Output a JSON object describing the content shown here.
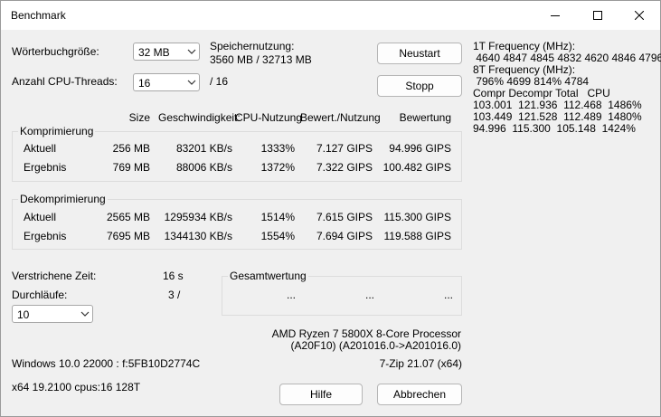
{
  "window": {
    "title": "Benchmark"
  },
  "settings": {
    "dict_label": "Wörterbuchgröße:",
    "dict_value": "32 MB",
    "threads_label": "Anzahl CPU-Threads:",
    "threads_value": "16",
    "threads_total": "/ 16",
    "memory_label": "Speichernutzung:",
    "memory_value": "3560 MB / 32713 MB"
  },
  "buttons": {
    "restart": "Neustart",
    "stop": "Stopp",
    "help": "Hilfe",
    "cancel": "Abbrechen"
  },
  "headers": {
    "size": "Size",
    "speed": "Geschwindigkeit:",
    "cpu": "CPU-Nutzung",
    "rating_usage": "Bewert./Nutzung",
    "rating": "Bewertung"
  },
  "compression": {
    "title": "Komprimierung",
    "rows": [
      {
        "label": "Aktuell",
        "size": "256 MB",
        "speed": "83201 KB/s",
        "cpu": "1333%",
        "rpu": "7.127 GIPS",
        "rating": "94.996 GIPS"
      },
      {
        "label": "Ergebnis",
        "size": "769 MB",
        "speed": "88006 KB/s",
        "cpu": "1372%",
        "rpu": "7.322 GIPS",
        "rating": "100.482 GIPS"
      }
    ]
  },
  "decompression": {
    "title": "Dekomprimierung",
    "rows": [
      {
        "label": "Aktuell",
        "size": "2565 MB",
        "speed": "1295934 KB/s",
        "cpu": "1514%",
        "rpu": "7.615 GIPS",
        "rating": "115.300 GIPS"
      },
      {
        "label": "Ergebnis",
        "size": "7695 MB",
        "speed": "1344130 KB/s",
        "cpu": "1554%",
        "rpu": "7.694 GIPS",
        "rating": "119.588 GIPS"
      }
    ]
  },
  "status": {
    "elapsed_label": "Verstrichene Zeit:",
    "elapsed_value": "16 s",
    "passes_label": "Durchläufe:",
    "passes_value": "3 /",
    "passes_select": "10"
  },
  "total": {
    "title": "Gesamtwertung",
    "v1": "...",
    "v2": "...",
    "v3": "..."
  },
  "system": {
    "cpu_name": "AMD Ryzen 7 5800X 8-Core Processor",
    "cpu_id": "(A20F10) (A201016.0->A201016.0)",
    "os": "Windows 10.0 22000 : f:5FB10D2774C",
    "version": "7-Zip 21.07 (x64)",
    "arch": "x64 19.2100 cpus:16 128T"
  },
  "info_lines": [
    "1T Frequency (MHz):",
    " 4640 4847 4845 4832 4620 4846 4796",
    "8T Frequency (MHz):",
    " 796% 4699 814% 4784",
    "Compr Decompr Total   CPU",
    "103.001  121.936  112.468  1486%",
    "103.449  121.528  112.489  1480%",
    "94.996  115.300  105.148  1424%"
  ]
}
